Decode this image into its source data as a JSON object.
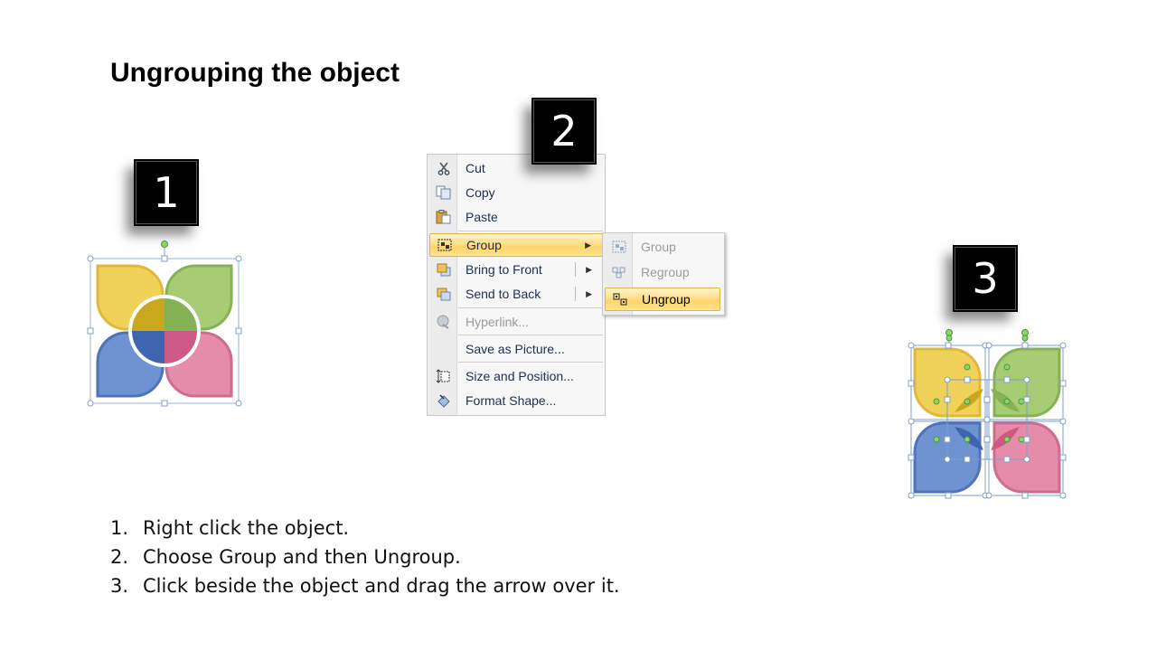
{
  "title": "Ungrouping the object",
  "badges": [
    "1",
    "2",
    "3"
  ],
  "colors": {
    "yellow": "#f0d25a",
    "green": "#a6cc74",
    "blue": "#6f92d0",
    "pink": "#e58caa",
    "highlight": "#fed56c"
  },
  "context_menu": {
    "items": [
      {
        "label": "Cut",
        "icon": "scissors-icon"
      },
      {
        "label": "Copy",
        "icon": "copy-icon"
      },
      {
        "label": "Paste",
        "icon": "paste-icon"
      },
      {
        "label": "Group",
        "icon": "group-icon",
        "submenu": true,
        "highlighted": true
      },
      {
        "label": "Bring to Front",
        "icon": "bring-to-front-icon",
        "submenu": true
      },
      {
        "label": "Send to Back",
        "icon": "send-to-back-icon",
        "submenu": true
      },
      {
        "label": "Hyperlink...",
        "icon": "hyperlink-icon",
        "disabled": true
      },
      {
        "label": "Save as Picture...",
        "icon": ""
      },
      {
        "label": "Size and Position...",
        "icon": "size-position-icon"
      },
      {
        "label": "Format Shape...",
        "icon": "format-shape-icon"
      }
    ]
  },
  "group_submenu": {
    "items": [
      {
        "label": "Group",
        "icon": "group-icon",
        "disabled": true
      },
      {
        "label": "Regroup",
        "icon": "regroup-icon",
        "disabled": true
      },
      {
        "label": "Ungroup",
        "icon": "ungroup-icon",
        "highlighted": true
      }
    ]
  },
  "steps": [
    {
      "num": "1.",
      "text": "Right click the object."
    },
    {
      "num": "2.",
      "text": "Choose Group and then Ungroup."
    },
    {
      "num": "3.",
      "text": "Click beside the object and drag the arrow over it."
    }
  ]
}
